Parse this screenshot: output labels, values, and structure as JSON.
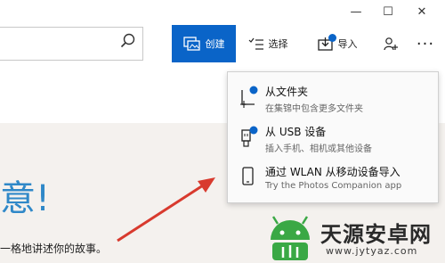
{
  "window": {
    "minimize": "—",
    "maximize": "☐",
    "close": "✕"
  },
  "search": {
    "placeholder": "",
    "value": ""
  },
  "toolbar": {
    "create_label": "创建",
    "select_label": "选择",
    "import_label": "导入",
    "more_label": "···"
  },
  "menu": {
    "items": [
      {
        "title": "从文件夹",
        "subtitle": "在集锦中包含更多文件夹"
      },
      {
        "title": "从 USB 设备",
        "subtitle": "插入手机、相机或其他设备"
      },
      {
        "title": "通过 WLAN 从移动设备导入",
        "subtitle": "Try the Photos Companion app"
      }
    ]
  },
  "content": {
    "heading_fragment": "意!",
    "story_text": "一格地讲述你的故事。"
  },
  "watermark": {
    "title": "天源安卓网",
    "url": "www.jytyaz.com"
  },
  "colors": {
    "accent": "#0a64c8",
    "heading": "#2f88c8",
    "arrow": "#d83a2e",
    "watermark_green": "#3aa845"
  }
}
